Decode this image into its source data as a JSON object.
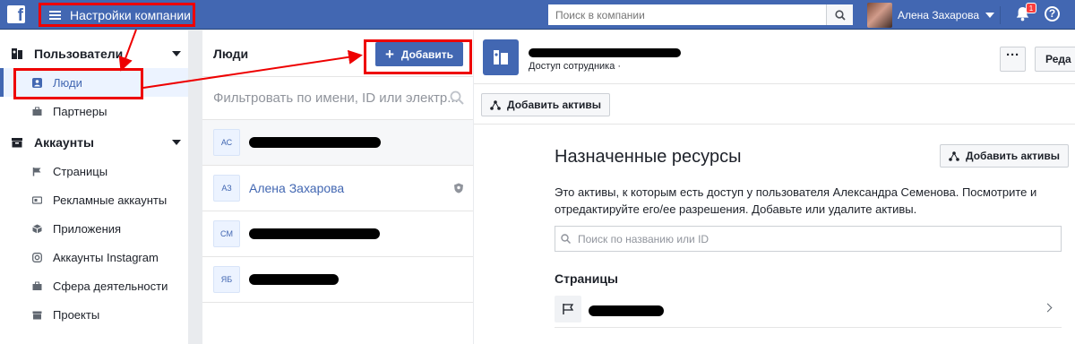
{
  "topbar": {
    "logo_letter": "f",
    "company_menu_label": "Настройки компании",
    "search_placeholder": "Поиск в компании",
    "user_name": "Алена Захарова",
    "notification_count": "1",
    "help_label": "?",
    "bg_color": "#4267b2"
  },
  "sidebar": {
    "sections": [
      {
        "label": "Пользователи",
        "icon": "users-icon",
        "items": [
          {
            "label": "Люди",
            "icon": "person-icon",
            "active": true
          },
          {
            "label": "Партнеры",
            "icon": "briefcase-icon"
          }
        ]
      },
      {
        "label": "Аккаунты",
        "icon": "folder-icon",
        "items": [
          {
            "label": "Страницы",
            "icon": "flag-icon"
          },
          {
            "label": "Рекламные аккаунты",
            "icon": "ad-account-icon"
          },
          {
            "label": "Приложения",
            "icon": "cube-icon"
          },
          {
            "label": "Аккаунты Instagram",
            "icon": "instagram-icon"
          },
          {
            "label": "Сфера деятельности",
            "icon": "briefcase-icon"
          },
          {
            "label": "Проекты",
            "icon": "folder-icon"
          }
        ]
      }
    ]
  },
  "people_panel": {
    "title": "Люди",
    "add_button": "Добавить",
    "filter_placeholder": "Фильтровать по имени, ID или электр...",
    "people": [
      {
        "initials": "АС",
        "name": "",
        "redacted": true
      },
      {
        "initials": "АЗ",
        "name": "Алена Захарова",
        "redacted": false
      },
      {
        "initials": "СМ",
        "name": "",
        "redacted": true
      },
      {
        "initials": "ЯБ",
        "name": "",
        "redacted": true
      }
    ]
  },
  "detail": {
    "role": "Доступ сотрудника",
    "role_suffix": "·",
    "more_label": "···",
    "edit_label": "Реда",
    "toolbar_add_assets": "Добавить активы",
    "resources_title": "Назначенные ресурсы",
    "resources_add_assets": "Добавить активы",
    "description": "Это активы, к которым есть доступ у пользователя Александра Семенова. Посмотрите и отредактируйте его/ее разрешения. Добавьте или удалите активы.",
    "search_placeholder": "Поиск по названию или ID",
    "pages_label": "Страницы"
  }
}
